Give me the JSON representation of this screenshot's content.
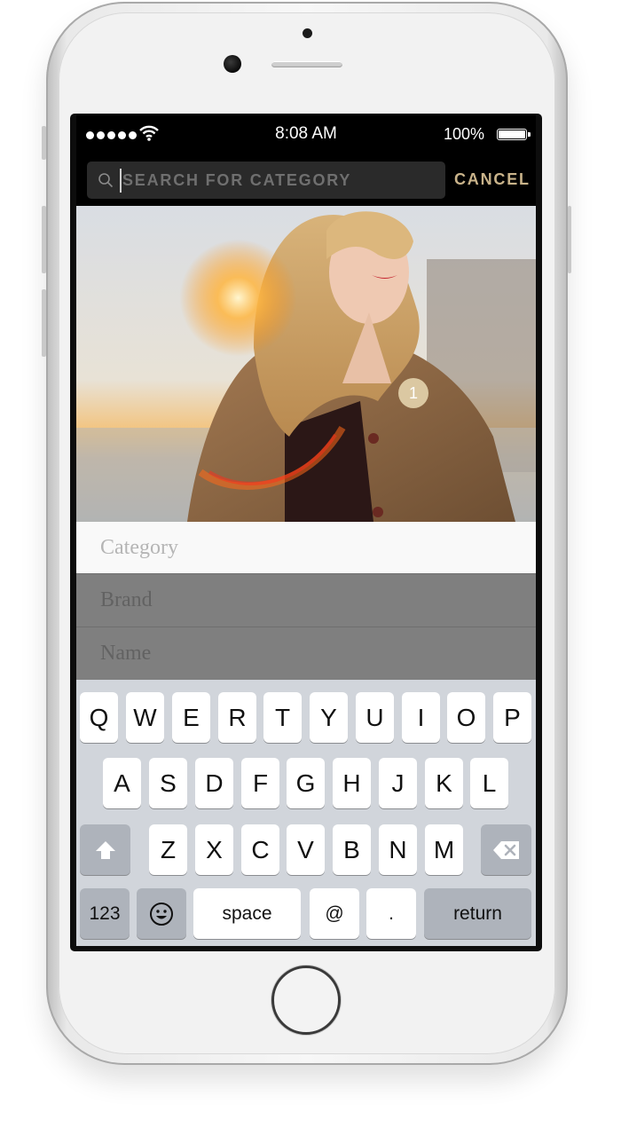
{
  "status_bar": {
    "time": "8:08 AM",
    "battery_percent": "100%",
    "signal_bars": 5,
    "wifi_icon": "wifi-icon",
    "battery_icon": "battery-full-icon"
  },
  "search": {
    "placeholder": "SEARCH FOR CATEGORY",
    "value": "",
    "icon": "search-icon",
    "cancel_label": "CANCEL"
  },
  "photo": {
    "tag_number": "1"
  },
  "fields": {
    "category": "Category",
    "brand": "Brand",
    "name": "Name"
  },
  "keyboard": {
    "row1": [
      "Q",
      "W",
      "E",
      "R",
      "T",
      "Y",
      "U",
      "I",
      "O",
      "P"
    ],
    "row2": [
      "A",
      "S",
      "D",
      "F",
      "G",
      "H",
      "J",
      "K",
      "L"
    ],
    "row3": [
      "Z",
      "X",
      "C",
      "V",
      "B",
      "N",
      "M"
    ],
    "numbers_label": "123",
    "space_label": "space",
    "at_label": "@",
    "period_label": ".",
    "return_label": "return",
    "shift_icon": "shift-icon",
    "delete_icon": "delete-icon",
    "emoji_icon": "emoji-icon"
  },
  "colors": {
    "accent": "#c9b38a",
    "keyboard_bg": "#d1d5db",
    "dim_overlay": "#7f7f7f"
  }
}
